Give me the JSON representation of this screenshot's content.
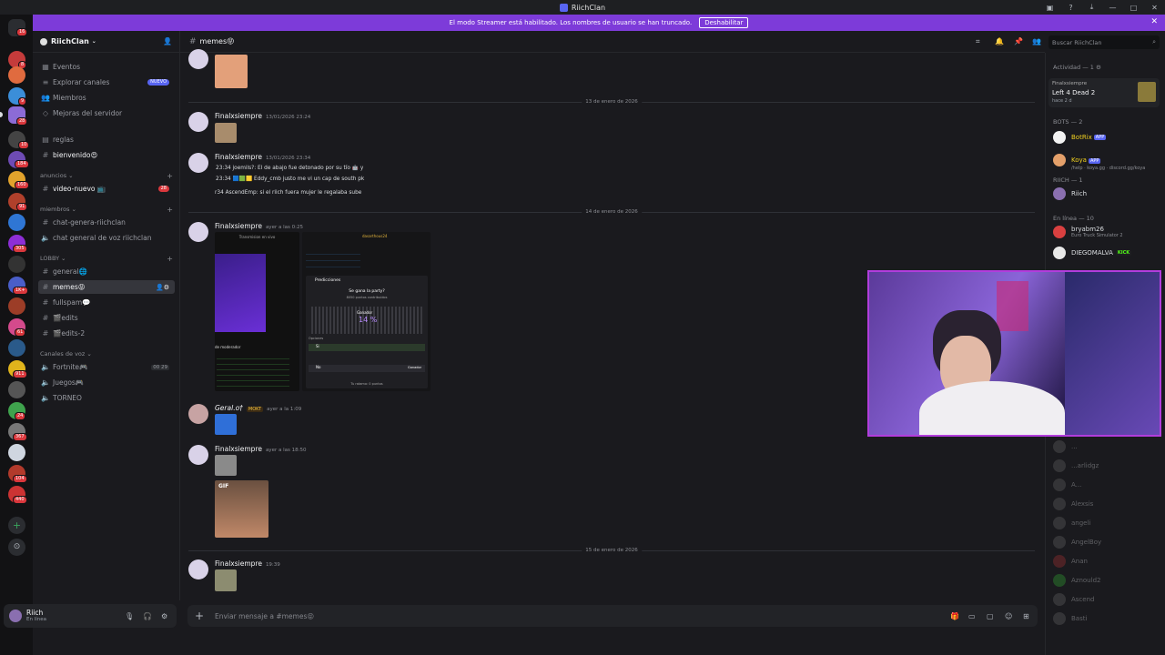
{
  "window": {
    "title": "RiichClan"
  },
  "banner": {
    "text": "El modo Streamer está habilitado. Los nombres de usuario se han truncado.",
    "button": "Deshabilitar"
  },
  "servers": {
    "badges": [
      "16",
      "8",
      "9",
      "3",
      "28",
      "10",
      "184",
      "160",
      "91",
      "6",
      "305",
      "8",
      "1K+",
      "9",
      "61",
      "8",
      "911",
      "6",
      "24",
      "367",
      "6",
      "104",
      "440"
    ]
  },
  "guild": {
    "name": "RiichClan"
  },
  "sidebar": {
    "top": [
      {
        "label": "Eventos"
      },
      {
        "label": "Explorar canales",
        "badge": "NUEVO"
      },
      {
        "label": "Miembros"
      },
      {
        "label": "Mejoras del servidor"
      }
    ],
    "channels1": [
      {
        "label": "reglas"
      },
      {
        "label": "bienvenido😍"
      }
    ],
    "cat_anuncios": "anuncios",
    "anuncios": [
      {
        "label": "video-nuevo 📺",
        "badge": "28"
      }
    ],
    "cat_miembros": "miembros",
    "miembros": [
      {
        "label": "chat-genera-riichclan"
      },
      {
        "label": "chat general de voz riichclan"
      }
    ],
    "cat_lobby": "LOBBY",
    "lobby": [
      {
        "label": "general🌐"
      },
      {
        "label": "memes😝"
      },
      {
        "label": "fullspam💬"
      },
      {
        "label": "🎬edits"
      },
      {
        "label": "🎬edits-2"
      }
    ],
    "cat_voz": "Canales de voz",
    "voz": [
      {
        "label": "Fortnite🎮",
        "count1": "00",
        "count2": "29"
      },
      {
        "label": "Juegos🎮"
      },
      {
        "label": "TORNEO"
      }
    ]
  },
  "user": {
    "name": "Riich",
    "status": "En línea"
  },
  "channel": {
    "name": "memes😝"
  },
  "search": {
    "placeholder": "Buscar RiichClan"
  },
  "messages": {
    "div1": "13 de enero de 2026",
    "m1": {
      "author": "Finalxsiempre",
      "time": "13/01/2026 23:24"
    },
    "m2": {
      "author": "Finalxsiempre",
      "time": "13/01/2026 23:34",
      "lines": [
        "23:34 joemils?: El de abajo fue detonado por su tío 🤖 y",
        "23:34 🟦🟩🟨 Eddy_cmb justo me vi un cap de south pk",
        "r34 AscendEmp: si el riich fuera mujer le regalaba sube"
      ]
    },
    "div2": "14 de enero de 2026",
    "m3": {
      "author": "Finalxsiempre",
      "time": "ayer a las 0:25"
    },
    "m4": {
      "author": "Geral.o†",
      "tag": "MOKT",
      "time": "ayer a la 1:09"
    },
    "m5": {
      "author": "Finalxsiempre",
      "time": "ayer a las 18:50"
    },
    "gif": "GIF",
    "div3": "15 de enero de 2026",
    "m6": {
      "author": "Finalxsiempre",
      "time": "19:39"
    }
  },
  "screenshot": {
    "stream_label": "Transmision en vivo",
    "pred_title": "Predicciones",
    "pred_q": "Se gana la party?",
    "pred_sub": "8050 puntos contribuidos",
    "pred_winner": "Ganador",
    "pred_pct": "14 %",
    "pred_opts": "Opciones",
    "pred_si": "Si",
    "pred_no": "No",
    "pred_btn": "Ganador",
    "pred_foot": "Tu ratamo: 0 puntos",
    "mod": "de moderador",
    "chatter": "dasarthous24"
  },
  "composer": {
    "placeholder": "Enviar mensaje a #memes😝"
  },
  "members": {
    "activity_head": "Actividad — 1",
    "activity_user": "Finalxsiempre",
    "activity_game": "Left 4 Dead 2",
    "activity_time": "hace 2 d",
    "bots_head": "BOTS — 2",
    "bots": [
      {
        "name": "BotRix",
        "tag": "APP"
      },
      {
        "name": "Koya",
        "tag": "APP",
        "status": "/help · koya.gg · discord.gg/koya"
      }
    ],
    "riich_head": "RIICH — 1",
    "riich": "Riich",
    "online_head": "En línea — 10",
    "online": [
      {
        "name": "bryabm26",
        "status": "Euro Truck Simulator 2"
      },
      {
        "name": "DIEGOMALVA",
        "tag": "KICK"
      }
    ],
    "faded": [
      "...",
      "...arlidgz",
      "A...",
      "Alexsis",
      "angeli",
      "AngelBoy",
      "Anan",
      "Aznould2",
      "Ascend",
      "Basti"
    ]
  }
}
